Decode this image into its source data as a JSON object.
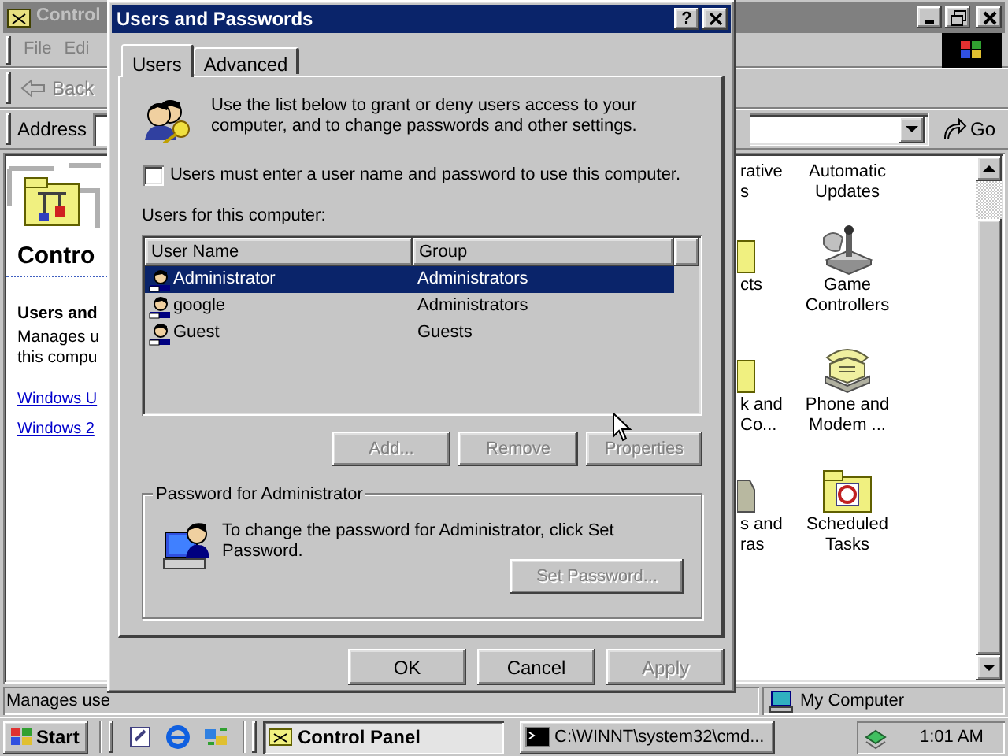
{
  "background_window": {
    "title": "Control",
    "menu": [
      "File",
      "Edi"
    ],
    "back_button": "Back",
    "address_label": "Address",
    "go_button": "Go",
    "left_pane": {
      "heading": "Contro",
      "item_title": "Users and",
      "description_lines": [
        "Manages u",
        "this compu"
      ],
      "links": [
        "Windows U",
        "Windows 2"
      ]
    },
    "icon_columns": [
      [
        {
          "kind": "none",
          "lines": [
            "rative",
            "s"
          ]
        },
        {
          "kind": "partial-folder",
          "lines": [
            "cts"
          ]
        },
        {
          "kind": "partial-folder",
          "lines": [
            "k and",
            "Co..."
          ]
        },
        {
          "kind": "partial-gray",
          "lines": [
            "s and",
            "ras"
          ]
        }
      ],
      [
        {
          "kind": "none",
          "lines": [
            "Automatic",
            "Updates"
          ]
        },
        {
          "kind": "joystick",
          "lines": [
            "Game",
            "Controllers"
          ]
        },
        {
          "kind": "phone",
          "lines": [
            "Phone and",
            "Modem ..."
          ]
        },
        {
          "kind": "tasks",
          "lines": [
            "Scheduled",
            "Tasks"
          ]
        }
      ]
    ],
    "status_bar": {
      "text": "Manages use",
      "zone": "My Computer"
    }
  },
  "dialog": {
    "title": "Users and Passwords",
    "help_button": "?",
    "tabs": [
      {
        "label": "Users",
        "selected": true
      },
      {
        "label": "Advanced",
        "selected": false
      }
    ],
    "intro": "Use the list below to grant or deny users access to your computer, and to change passwords and other settings.",
    "require_login": {
      "label": "Users must enter a user name and password to use this computer.",
      "checked": false
    },
    "list_label": "Users for this computer:",
    "columns": [
      "User Name",
      "Group"
    ],
    "rows": [
      {
        "name": "Administrator",
        "group": "Administrators",
        "selected": true
      },
      {
        "name": "google",
        "group": "Administrators",
        "selected": false
      },
      {
        "name": "Guest",
        "group": "Guests",
        "selected": false
      }
    ],
    "list_buttons": [
      {
        "label": "Add...",
        "disabled": true
      },
      {
        "label": "Remove",
        "disabled": true
      },
      {
        "label": "Properties",
        "disabled": true
      }
    ],
    "password_group": {
      "title": "Password for Administrator",
      "text": "To change the password for Administrator, click Set Password.",
      "button": {
        "label": "Set Password...",
        "disabled": true
      }
    },
    "footer_buttons": [
      {
        "label": "OK",
        "disabled": false
      },
      {
        "label": "Cancel",
        "disabled": false
      },
      {
        "label": "Apply",
        "disabled": true
      }
    ]
  },
  "taskbar": {
    "start": "Start",
    "tasks": [
      {
        "kind": "folder",
        "label": "Control Panel",
        "selected": true
      },
      {
        "kind": "console",
        "label": "C:\\WINNT\\system32\\cmd...",
        "selected": false
      }
    ],
    "clock": "1:01 AM"
  }
}
